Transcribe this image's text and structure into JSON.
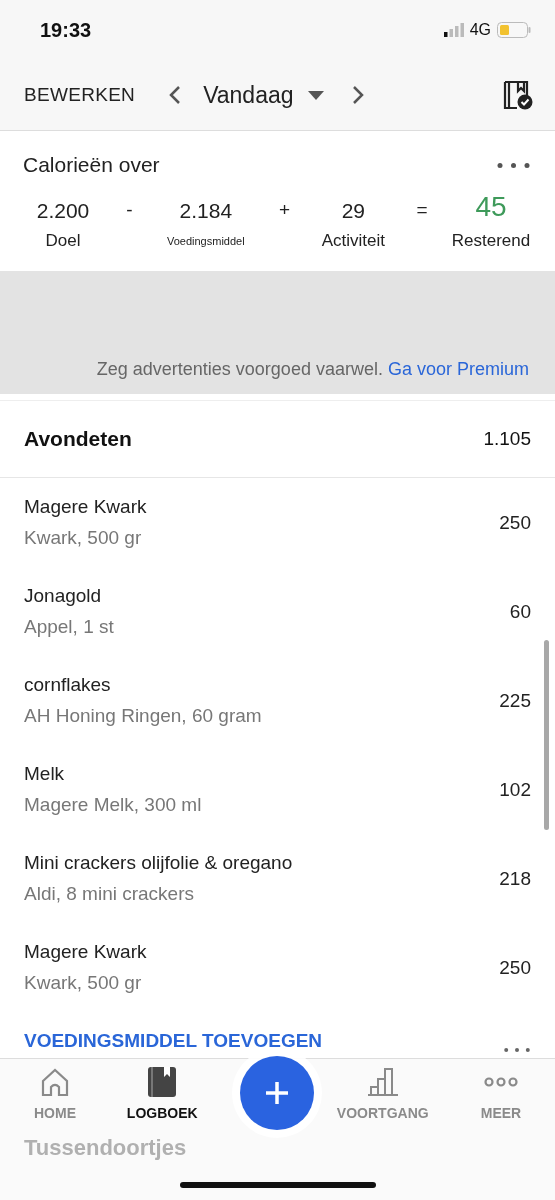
{
  "status_bar": {
    "time": "19:33",
    "network": "4G"
  },
  "header": {
    "edit": "BEWERKEN",
    "date": "Vandaag"
  },
  "summary": {
    "title": "Calorieën over",
    "terms": [
      {
        "value": "2.200",
        "label": "Doel",
        "kind": "normal"
      },
      {
        "operator": "-"
      },
      {
        "value": "2.184",
        "label": "Voedingsmiddel",
        "kind": "small"
      },
      {
        "operator": "+"
      },
      {
        "value": "29",
        "label": "Activiteit",
        "kind": "normal"
      },
      {
        "operator": "="
      },
      {
        "value": "45",
        "label": "Resterend",
        "kind": "result"
      }
    ]
  },
  "ad": {
    "text": "Zeg advertenties voorgoed vaarwel.",
    "link": "Ga voor Premium"
  },
  "meal": {
    "title": "Avondeten",
    "total": "1.105",
    "items": [
      {
        "name": "Magere Kwark",
        "detail": "Kwark, 500 gr",
        "calories": "250"
      },
      {
        "name": "Jonagold",
        "detail": "Appel, 1 st",
        "calories": "60"
      },
      {
        "name": "cornflakes",
        "detail": "AH Honing Ringen, 60 gram",
        "calories": "225"
      },
      {
        "name": "Melk",
        "detail": "Magere Melk, 300 ml",
        "calories": "102"
      },
      {
        "name": "Mini crackers olijfolie & oregano",
        "detail": "Aldi, 8 mini crackers",
        "calories": "218"
      },
      {
        "name": "Magere Kwark",
        "detail": "Kwark, 500 gr",
        "calories": "250"
      }
    ],
    "add": "VOEDINGSMIDDEL TOEVOEGEN"
  },
  "next_meal": {
    "title": "Tussendoortjes"
  },
  "tab_bar": {
    "tabs": [
      {
        "label": "HOME",
        "selected": false
      },
      {
        "label": "LOGBOEK",
        "selected": true
      },
      {
        "kind": "add"
      },
      {
        "label": "VOORTGANG",
        "selected": false
      },
      {
        "label": "MEER",
        "selected": false
      }
    ]
  }
}
